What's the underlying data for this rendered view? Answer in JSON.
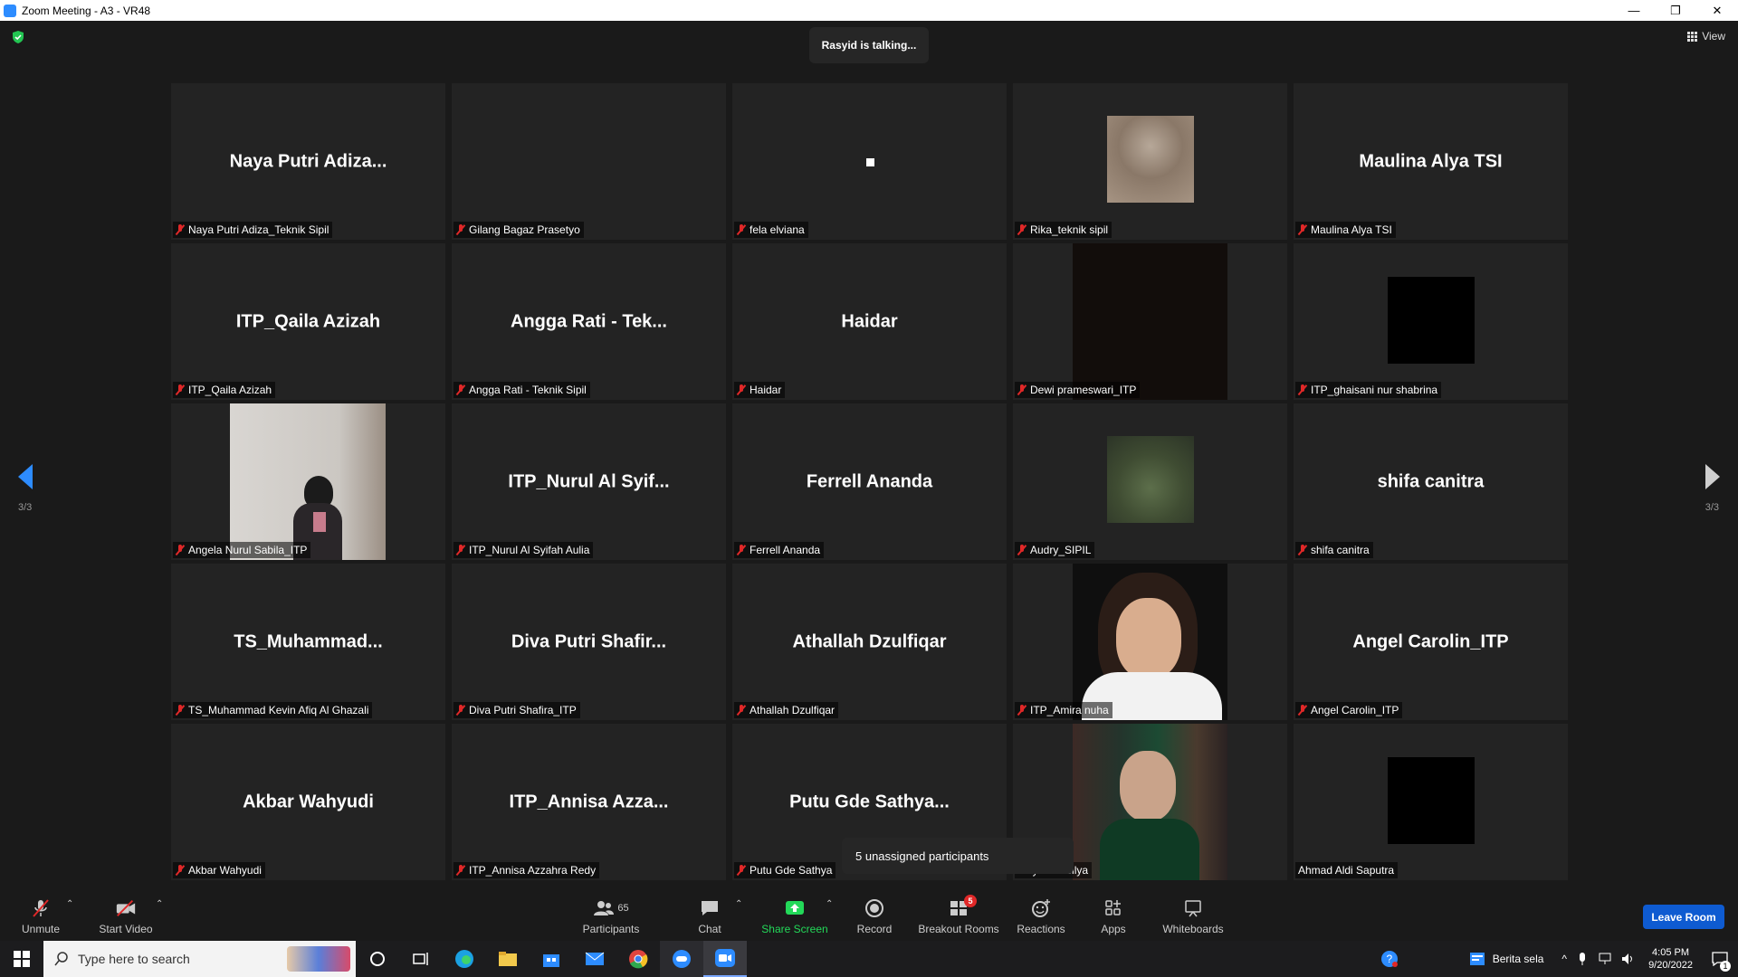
{
  "window": {
    "title": "Zoom Meeting - A3 - VR48",
    "minimize": "—",
    "restore": "❐",
    "close": "✕"
  },
  "meeting": {
    "talking_indicator": "Rasyid is talking...",
    "view_label": "View",
    "page_left": "3/3",
    "page_right": "3/3",
    "unassigned_popup": "5 unassigned participants"
  },
  "tiles": [
    {
      "display": "Naya Putri Adiza...",
      "label": "Naya Putri Adiza_Teknik Sipil",
      "muted": true
    },
    {
      "display": "",
      "label": "Gilang Bagaz Prasetyo",
      "muted": true
    },
    {
      "display": "",
      "label": "fela elviana",
      "muted": true
    },
    {
      "display": "",
      "label": "Rika_teknik sipil",
      "muted": true
    },
    {
      "display": "Maulina Alya TSI",
      "label": "Maulina Alya TSI",
      "muted": true
    },
    {
      "display": "ITP_Qaila Azizah",
      "label": "ITP_Qaila Azizah",
      "muted": true
    },
    {
      "display": "Angga Rati - Tek...",
      "label": "Angga Rati - Teknik Sipil",
      "muted": true
    },
    {
      "display": "Haidar",
      "label": "Haidar",
      "muted": true
    },
    {
      "display": "",
      "label": "Dewi prameswari_ITP",
      "muted": true
    },
    {
      "display": "",
      "label": "ITP_ghaisani nur shabrina",
      "muted": true
    },
    {
      "display": "",
      "label": "Angela Nurul Sabila_ITP",
      "muted": true
    },
    {
      "display": "ITP_Nurul Al Syif...",
      "label": "ITP_Nurul Al Syifah Aulia",
      "muted": true
    },
    {
      "display": "Ferrell Ananda",
      "label": "Ferrell Ananda",
      "muted": true
    },
    {
      "display": "",
      "label": "Audry_SIPIL",
      "muted": true
    },
    {
      "display": "shifa canitra",
      "label": "shifa canitra",
      "muted": true
    },
    {
      "display": "TS_Muhammad...",
      "label": "TS_Muhammad Kevin Afiq Al Ghazali",
      "muted": true
    },
    {
      "display": "Diva Putri Shafir...",
      "label": "Diva Putri Shafira_ITP",
      "muted": true
    },
    {
      "display": "Athallah Dzulfiqar",
      "label": "Athallah Dzulfiqar",
      "muted": true
    },
    {
      "display": "",
      "label": "ITP_Amira nuha",
      "muted": true
    },
    {
      "display": "Angel Carolin_ITP",
      "label": "Angel Carolin_ITP",
      "muted": true
    },
    {
      "display": "Akbar Wahyudi",
      "label": "Akbar Wahyudi",
      "muted": true
    },
    {
      "display": "ITP_Annisa Azza...",
      "label": "ITP_Annisa Azzahra Redy",
      "muted": true
    },
    {
      "display": "Putu Gde Sathya...",
      "label": "Putu Gde Sathya",
      "muted": true
    },
    {
      "display": "",
      "label": "amya Shesilya",
      "muted": false
    },
    {
      "display": "",
      "label": "Ahmad Aldi Saputra",
      "muted": false
    }
  ],
  "toolbar": {
    "unmute": "Unmute",
    "start_video": "Start Video",
    "participants": "Participants",
    "participants_count": "65",
    "chat": "Chat",
    "share_screen": "Share Screen",
    "record": "Record",
    "breakout_rooms": "Breakout Rooms",
    "breakout_badge": "5",
    "reactions": "Reactions",
    "apps": "Apps",
    "whiteboards": "Whiteboards",
    "leave": "Leave Room"
  },
  "taskbar": {
    "search_placeholder": "Type here to search",
    "news": "Berita sela",
    "time": "4:05 PM",
    "date": "9/20/2022",
    "notifications": "1"
  },
  "colors": {
    "accent": "#2d8cff",
    "muted_red": "#e02828",
    "share_green": "#23d959",
    "leave_blue": "#0e5bd1"
  }
}
